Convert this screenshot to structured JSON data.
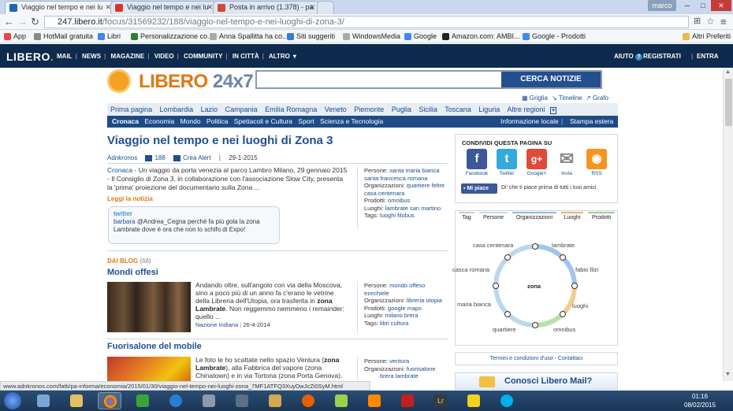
{
  "browser": {
    "tabs": [
      {
        "title": "Viaggio nel tempo e nei lu",
        "color": "#1f63b5"
      },
      {
        "title": "Viaggio nel tempo e nei lu",
        "color": "#d9342b"
      },
      {
        "title": "Posta in arrivo (1.378) - pa",
        "color": "#d14836"
      }
    ],
    "user": "marco",
    "url_host": "247.libero.it",
    "url_path": "/focus/31569232/188/viaggio-nel-tempo-e-nei-luoghi-di-zona-3/",
    "bookmarks": [
      "App",
      "HotMail gratuita",
      "Libri",
      "Personalizzazione co...",
      "Anna Spallitta ha co...",
      "Siti suggeriti",
      "WindowsMedia",
      "Google",
      "Amazon.com: AMBI...",
      "Google - Prodotti"
    ],
    "other_bookmarks": "Altri Preferiti",
    "status_url": "www.adnkronos.com/fatti/pa-informa/economia/2015/01/30/viaggio-nel-tempo-nei-luoghi-zona_7MF1ATFQ3XuyDwJcZi0SyM.html"
  },
  "libero_header": {
    "logo": "LIBERO",
    "nav": [
      "MAIL",
      "NEWS",
      "MAGAZINE",
      "VIDEO",
      "COMMUNITY",
      "IN CITTÀ",
      "ALTRO"
    ],
    "help": "AIUTO",
    "register": "REGISTRATI",
    "login": "ENTRA"
  },
  "brand": {
    "name": "LIBERO",
    "suffix": "24x7"
  },
  "search": {
    "button": "CERCA NOTIZIE"
  },
  "tools": [
    "Griglia",
    "Timeline",
    "Grafo"
  ],
  "regions": [
    "Prima pagina",
    "Lombardia",
    "Lazio",
    "Campania",
    "Emilia Romagna",
    "Veneto",
    "Piemonte",
    "Puglia",
    "Sicilia",
    "Toscana",
    "Liguria",
    "Altre regioni"
  ],
  "sections": [
    "Cronaca",
    "Economia",
    "Mondo",
    "Politica",
    "Spettacoli e Cultura",
    "Sport",
    "Scienza e Tecnologia"
  ],
  "sections_right": [
    "Informazione locale",
    "Stampa estera"
  ],
  "article": {
    "title": "Viaggio nel tempo e nei luoghi di Zona 3",
    "source": "Adnkronos",
    "count": "188",
    "alert": "Crea Alert",
    "date": "29-1-2015",
    "category": "Cronaca",
    "body": " - Un viaggio da porta venezia al parco Lambro Milano, 29 gennaio 2015 - Il Consiglio di Zona 3, in collaborazione con l'associazione Slow City, presenta la 'prima' proiezione del documentario sulla Zona ...",
    "read_more": "Leggi la notizia",
    "tweet_label": "twitter",
    "tweet_user": "barbara",
    "tweet_text": "@Andrea_Cegna perchè fa più gola la zona Lambrate dove è ora che non lo schifo di Expo!",
    "tags": [
      {
        "k": "Persone:",
        "v": "santa maria bianca"
      },
      {
        "k": "",
        "v": "santa francesca romana"
      },
      {
        "k": "Organizzazioni:",
        "v": "quartiere feltre"
      },
      {
        "k": "",
        "v": "casa centenara"
      },
      {
        "k": "Prodotti:",
        "v": "omnibus"
      },
      {
        "k": "Luoghi:",
        "v": "lambrate san martino"
      },
      {
        "k": "Tags:",
        "v": "luoghi filobus"
      }
    ]
  },
  "blog": {
    "header": "DAI BLOG",
    "count": "(68)",
    "posts": [
      {
        "title": "Mondi offesi",
        "text_a": "Andando oltre, sull'angolo con via della Moscova, sino a poco più di un anno fa c'erano le vetrine della Libreria dell'Utopia, ora trasferita in ",
        "bold": "zona Lambrate",
        "text_b": ". Non reggemmo nemmeno i remainder: quello ...",
        "source": "Nazione Indiana",
        "date": "26-4-2014",
        "tags": [
          {
            "k": "Persone:",
            "v": "mondo offeso"
          },
          {
            "k": "",
            "v": "ezechiele"
          },
          {
            "k": "Organizzazioni:",
            "v": "libreria utopia"
          },
          {
            "k": "Prodotti:",
            "v": "google maps"
          },
          {
            "k": "Luoghi:",
            "v": "milano brera"
          },
          {
            "k": "Tags:",
            "v": "libri cultura"
          }
        ]
      },
      {
        "title": "Fuorisalone del mobile",
        "text_a": "Le foto le ho scattate nello spazio Ventura (",
        "bold": "zona Lambrate",
        "text_b": "), alla Fabbrica del vapore (zona Chinatown) e in via Tortona (zona Porta Genova).",
        "tags": [
          {
            "k": "Persone:",
            "v": "ventura"
          },
          {
            "k": "Organizzazioni:",
            "v": "fuorisalone"
          },
          {
            "k": "",
            "v": "brera lambrate"
          }
        ]
      }
    ]
  },
  "share": {
    "title": "CONDIVIDI QUESTA PAGINA SU",
    "networks": [
      {
        "name": "Facebook",
        "glyph": "f",
        "color": "#3b5998"
      },
      {
        "name": "Twitter",
        "glyph": "t",
        "color": "#33aadd"
      },
      {
        "name": "Google+",
        "glyph": "g+",
        "color": "#dd4b39"
      },
      {
        "name": "Invia",
        "glyph": "✉",
        "color": "#ffffff"
      },
      {
        "name": "RSS",
        "glyph": "◉",
        "color": "#f7931e"
      }
    ],
    "like_button": "Mi piace",
    "like_text": "Di' che ti piace prima di tutti i tuoi amici."
  },
  "graph": {
    "tabs": [
      {
        "label": "Tag",
        "color": "#cccccc"
      },
      {
        "label": "Persone",
        "color": "#c7d9ec"
      },
      {
        "label": "Organizzazioni",
        "color": "#8fb8e0"
      },
      {
        "label": "Luoghi",
        "color": "#f0b070"
      },
      {
        "label": "Prodotti",
        "color": "#9ad18b"
      }
    ],
    "center": "zona",
    "nodes": [
      "lambrate",
      "fabio filzi",
      "luoghi",
      "omnibus",
      "quartiere",
      "maria bianca",
      "casca romana",
      "casa centenara"
    ]
  },
  "terms": "Termini e condizioni d'uso - Contattaci",
  "mail_ad": "Conosci Libero Mail?",
  "clock": {
    "time": "01:16",
    "date": "08/02/2015"
  }
}
